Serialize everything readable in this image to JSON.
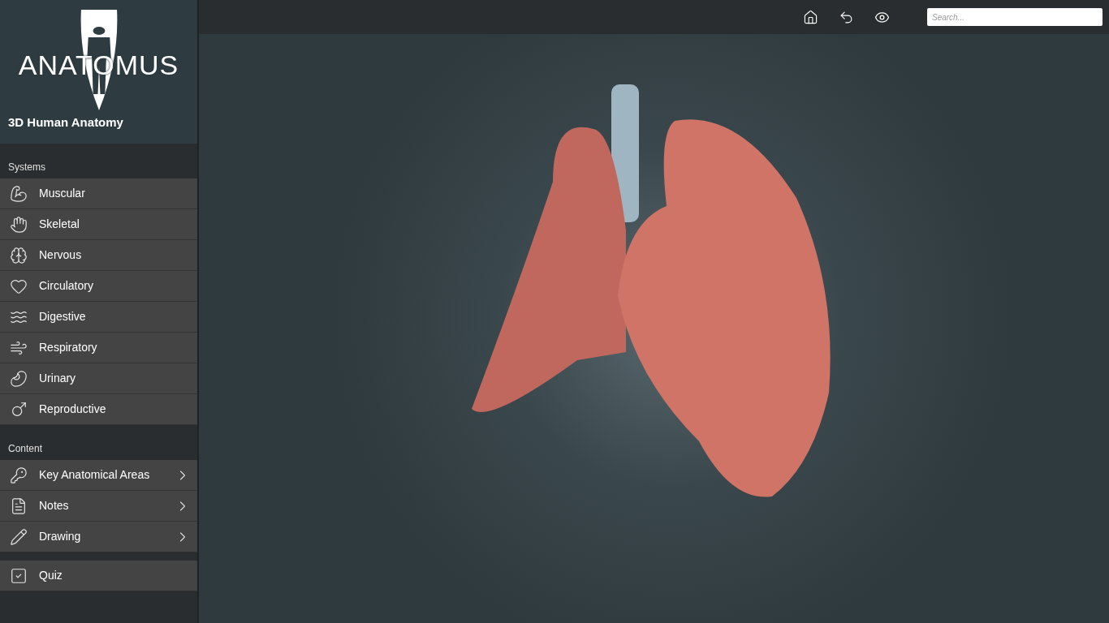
{
  "app": {
    "logo": "ANATOMUS",
    "subtitle": "3D Human Anatomy"
  },
  "toolbar": {
    "search": {
      "placeholder": "Search..."
    }
  },
  "sidebar": {
    "sections": [
      {
        "heading": "Systems",
        "items": [
          {
            "label": "Muscular",
            "has_submenu": false
          },
          {
            "label": "Skeletal",
            "has_submenu": false
          },
          {
            "label": "Nervous",
            "has_submenu": false
          },
          {
            "label": "Circulatory",
            "has_submenu": false
          },
          {
            "label": "Digestive",
            "has_submenu": false
          },
          {
            "label": "Respiratory",
            "has_submenu": false
          },
          {
            "label": "Urinary",
            "has_submenu": false
          },
          {
            "label": "Reproductive",
            "has_submenu": false
          }
        ]
      },
      {
        "heading": "Content",
        "items": [
          {
            "label": "Key Anatomical Areas",
            "has_submenu": true
          },
          {
            "label": "Notes",
            "has_submenu": true
          },
          {
            "label": "Drawing",
            "has_submenu": true
          }
        ]
      }
    ],
    "quiz": {
      "label": "Quiz"
    }
  }
}
